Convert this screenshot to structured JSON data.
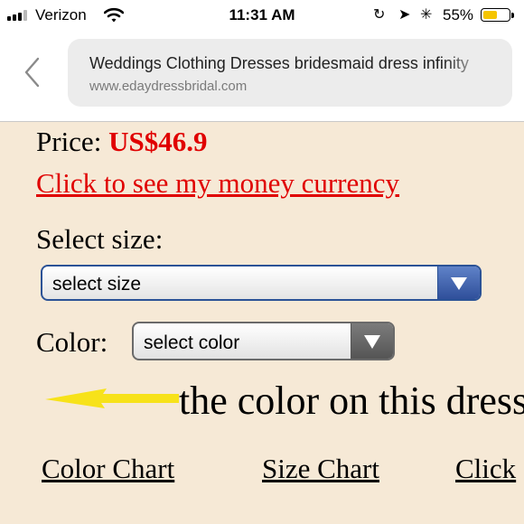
{
  "status_bar": {
    "carrier": "Verizon",
    "time": "11:31 AM",
    "battery_percent": "55%",
    "battery_level": 0.55,
    "icons": [
      "signal-icon",
      "wifi-icon",
      "orientation-lock-icon",
      "location-arrow-icon",
      "bluetooth-icon",
      "battery-icon"
    ]
  },
  "browser": {
    "page_title": "Weddings Clothing Dresses bridesmaid dress infinity",
    "url": "www.edaydressbridal.com",
    "back_icon": "chevron-left-icon"
  },
  "product": {
    "price_label": "Price:",
    "price_value": "US$46.9",
    "currency_link": "Click to see my money currency",
    "size_label": "Select size:",
    "size_select": "select size",
    "color_label": "Color:",
    "color_select": "select color",
    "color_note": "the color on this dress",
    "links": [
      "Color Chart",
      "Size Chart",
      "Click"
    ]
  },
  "colors": {
    "page_background": "#f6e9d6",
    "price_red": "#e00000",
    "size_select_accent": "#2b5296",
    "arrow_yellow": "#f7e21a"
  }
}
